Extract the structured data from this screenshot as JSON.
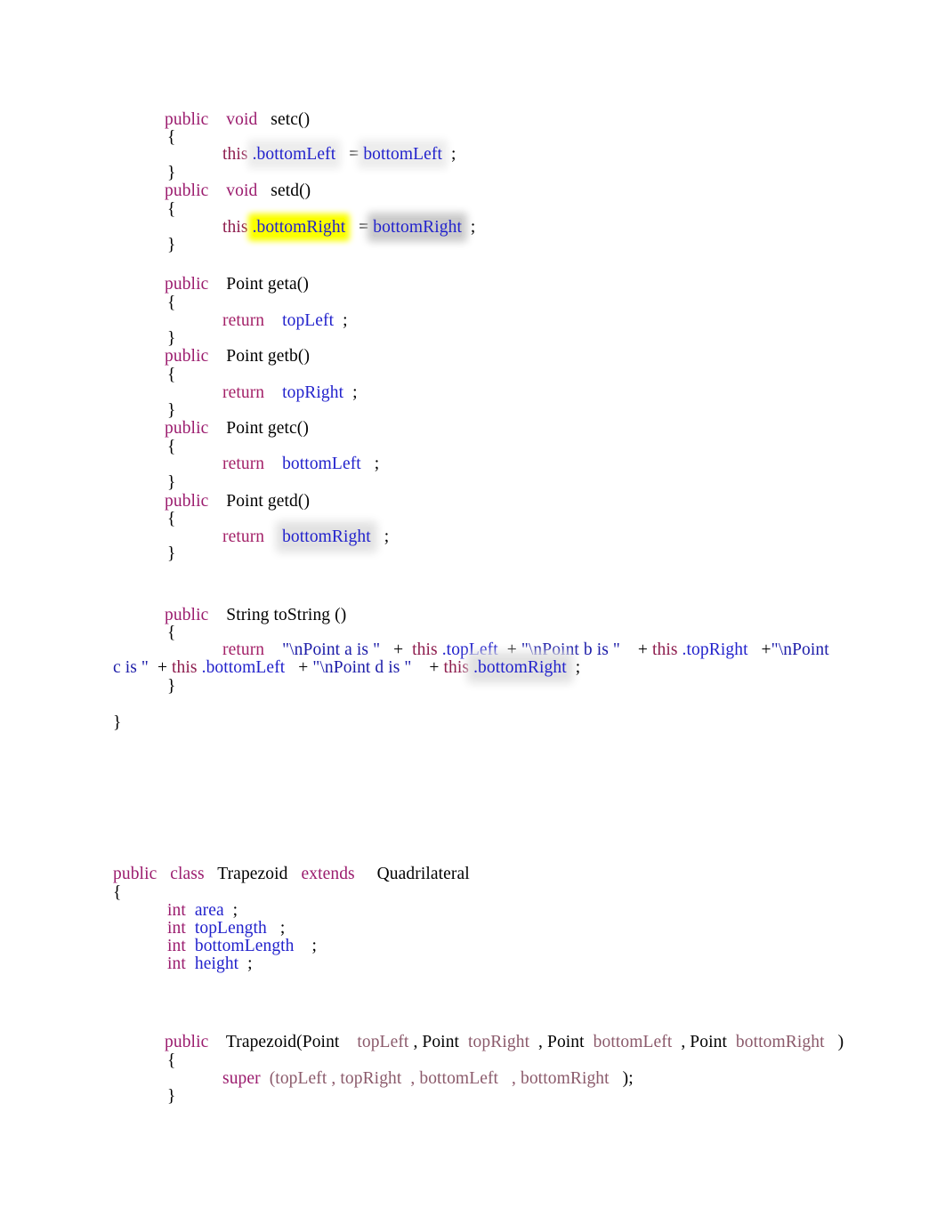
{
  "document": {
    "language": "Java",
    "background_color": "#ffffff",
    "colors": {
      "keyword": "#9B1C6E",
      "return_keyword": "#A32168",
      "this_keyword": "#8E1D4E",
      "identifier": "#2222CC",
      "string_literal": "#1C1CA8",
      "plain": "#000000",
      "muted_param": "#8B5A6B",
      "highlight_yellow": "#fbff00",
      "highlight_gray": "#cbcbcb"
    }
  },
  "quadrilateral_section": {
    "setc": {
      "signature_kw_public": "public",
      "signature_kw_void": "void",
      "signature_name": "setc()",
      "open_brace": "{",
      "body_this": "this",
      "body_field": ".bottomLeft",
      "body_equals": "=",
      "body_value": "bottomLeft",
      "body_semicolon": ";",
      "close_brace": "}"
    },
    "setd": {
      "signature_kw_public": "public",
      "signature_kw_void": "void",
      "signature_name": "setd()",
      "open_brace": "{",
      "body_this": "this",
      "body_field": ".bottomRight",
      "body_equals": "=",
      "body_value": "bottomRight",
      "body_semicolon": ";",
      "close_brace": "}"
    },
    "geta": {
      "kw_public": "public",
      "return_type_name": "Point geta()",
      "open_brace": "{",
      "kw_return": "return",
      "value": "topLeft",
      "semicolon": ";",
      "close_brace": "}"
    },
    "getb": {
      "kw_public": "public",
      "return_type_name": "Point getb()",
      "open_brace": "{",
      "kw_return": "return",
      "value": "topRight",
      "semicolon": ";",
      "close_brace": "}"
    },
    "getc": {
      "kw_public": "public",
      "return_type_name": "Point getc()",
      "open_brace": "{",
      "kw_return": "return",
      "value": "bottomLeft",
      "semicolon": ";",
      "close_brace": "}"
    },
    "getd": {
      "kw_public": "public",
      "return_type_name": "Point getd()",
      "open_brace": "{",
      "kw_return": "return",
      "value": "bottomRight",
      "semicolon": ";",
      "close_brace": "}"
    },
    "tostring": {
      "kw_public": "public",
      "return_type_name": "String toString ()",
      "open_brace": "{",
      "kw_return": "return",
      "str_a": "\"\\nPoint a is \"",
      "plus1": "+",
      "this1": "this",
      "field1": ".topLeft",
      "plus2": "+",
      "str_b": "\"\\nPoint b is \"",
      "plus3": "+",
      "this2": "this",
      "field2": ".topRight",
      "plus4": "+",
      "str_c_part1": "\"\\nPoint",
      "str_c_part2": "c is \"",
      "plus5": "+",
      "this3": "this",
      "field3": ".bottomLeft",
      "plus6": "+",
      "str_d": "\"\\nPoint d is \"",
      "plus7": "+",
      "this4": "this",
      "field4": ".bottomRight",
      "semicolon": ";",
      "close_brace": "}"
    },
    "class_close_brace": "}"
  },
  "trapezoid_section": {
    "class_declaration": {
      "kw_public": "public",
      "kw_class": "class",
      "class_name": "Trapezoid",
      "kw_extends": "extends",
      "super_class": "Quadrilateral"
    },
    "open_brace": "{",
    "fields": [
      {
        "type": "int",
        "name": "area",
        "semicolon": ";"
      },
      {
        "type": "int",
        "name": "topLength",
        "semicolon": ";"
      },
      {
        "type": "int",
        "name": "bottomLength",
        "semicolon": ";"
      },
      {
        "type": "int",
        "name": "height",
        "semicolon": ";"
      }
    ],
    "constructor": {
      "kw_public": "public",
      "name_open": "Trapezoid(Point",
      "param1": "topLeft",
      "comma1": ", Point",
      "param2": "topRight",
      "comma2": ", Point",
      "param3": "bottomLeft",
      "comma3": ", Point",
      "param4": "bottomRight",
      "close_paren": ")",
      "open_brace": "{",
      "kw_super": "super",
      "super_open_paren": "(",
      "arg1": "topLeft",
      "arg_comma1": ",",
      "arg2": "topRight",
      "arg_comma2": ",",
      "arg3": "bottomLeft",
      "arg_comma3": ",",
      "arg4": "bottomRight",
      "super_close": ");",
      "close_brace": "}"
    }
  }
}
